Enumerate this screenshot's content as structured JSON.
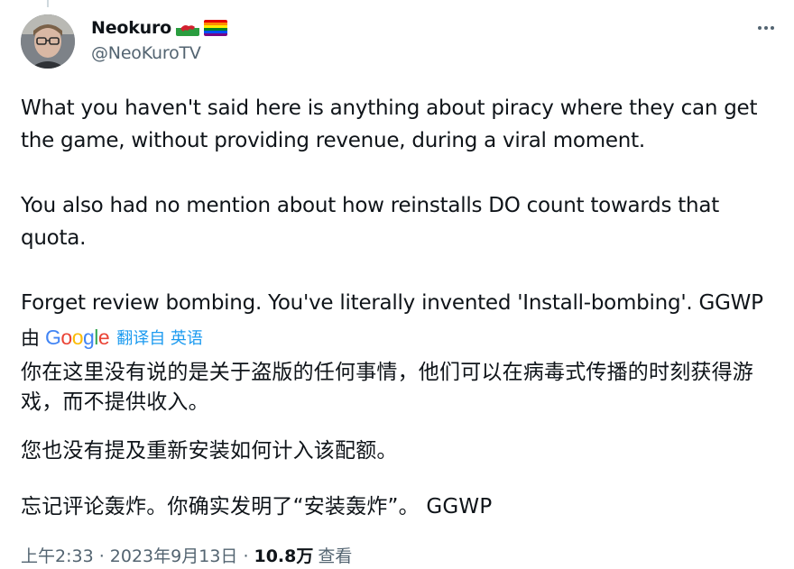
{
  "author": {
    "display_name": "Neokuro",
    "handle": "@NeoKuroTV",
    "flags": [
      "wales-flag",
      "rainbow-flag"
    ]
  },
  "tweet": {
    "paragraph_1": "What you haven't said here is anything about piracy where they can get the game, without providing revenue, during a viral moment.",
    "paragraph_2": "You also had no mention about how reinstalls DO count towards that quota.",
    "paragraph_3": "Forget review bombing. You've literally invented 'Install-bombing'. GGWP"
  },
  "translation": {
    "by_label": "由",
    "provider": "Google",
    "link_label": "翻译自 英语",
    "paragraph_1": "你在这里没有说的是关于盗版的任何事情，他们可以在病毒式传播的时刻获得游戏，而不提供收入。",
    "paragraph_2": "您也没有提及重新安装如何计入该配额。",
    "paragraph_3": "忘记评论轰炸。你确实发明了“安装轰炸”。 GGWP"
  },
  "meta": {
    "time_date": "上午2:33 · 2023年9月13日 ·",
    "views_count": "10.8万",
    "views_label": "查看"
  },
  "icons": {
    "more": "more-dots-icon"
  },
  "colors": {
    "accent": "#1d9bf0",
    "secondary_text": "#536471",
    "primary_text": "#0f1419"
  }
}
